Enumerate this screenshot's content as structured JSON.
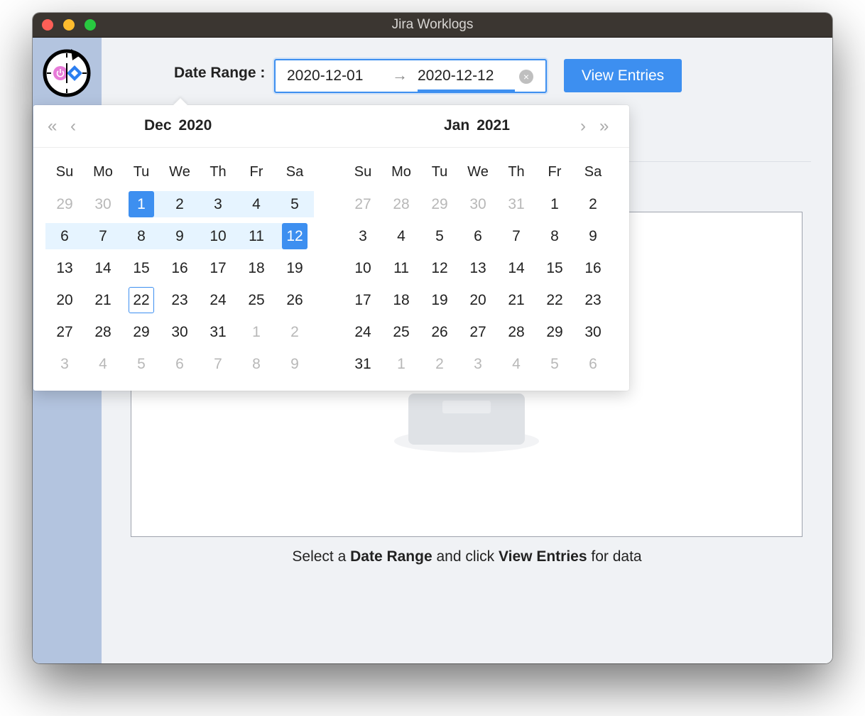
{
  "window": {
    "title": "Jira Worklogs"
  },
  "toolbar": {
    "date_range_label": "Date Range :",
    "start_date": "2020-12-01",
    "range_arrow": "→",
    "end_date": "2020-12-12",
    "clear_icon": "×",
    "view_button": "View Entries"
  },
  "empty_state": {
    "part1": "Select a ",
    "bold1": "Date Range",
    "part2": " and click ",
    "bold2": "View Entries",
    "part3": " for data"
  },
  "colors": {
    "accent": "#3d8ff0",
    "range_fill": "#e6f4ff",
    "sidebar": "#b3c4df"
  },
  "calendar": {
    "weekdays": [
      "Su",
      "Mo",
      "Tu",
      "We",
      "Th",
      "Fr",
      "Sa"
    ],
    "nav": {
      "super_prev": "«",
      "prev": "‹",
      "next": "›",
      "super_next": "»"
    },
    "left": {
      "month": "Dec",
      "year": "2020",
      "weeks": [
        [
          "29",
          "30",
          "1",
          "2",
          "3",
          "4",
          "5"
        ],
        [
          "6",
          "7",
          "8",
          "9",
          "10",
          "11",
          "12"
        ],
        [
          "13",
          "14",
          "15",
          "16",
          "17",
          "18",
          "19"
        ],
        [
          "20",
          "21",
          "22",
          "23",
          "24",
          "25",
          "26"
        ],
        [
          "27",
          "28",
          "29",
          "30",
          "31",
          "1",
          "2"
        ],
        [
          "3",
          "4",
          "5",
          "6",
          "7",
          "8",
          "9"
        ]
      ],
      "other_month": [
        [
          1,
          1,
          0,
          0,
          0,
          0,
          0
        ],
        [
          0,
          0,
          0,
          0,
          0,
          0,
          0
        ],
        [
          0,
          0,
          0,
          0,
          0,
          0,
          0
        ],
        [
          0,
          0,
          0,
          0,
          0,
          0,
          0
        ],
        [
          0,
          0,
          0,
          0,
          0,
          1,
          1
        ],
        [
          1,
          1,
          1,
          1,
          1,
          1,
          1
        ]
      ],
      "range_start": [
        0,
        2
      ],
      "range_end": [
        1,
        6
      ],
      "today": [
        3,
        2
      ]
    },
    "right": {
      "month": "Jan",
      "year": "2021",
      "weeks": [
        [
          "27",
          "28",
          "29",
          "30",
          "31",
          "1",
          "2"
        ],
        [
          "3",
          "4",
          "5",
          "6",
          "7",
          "8",
          "9"
        ],
        [
          "10",
          "11",
          "12",
          "13",
          "14",
          "15",
          "16"
        ],
        [
          "17",
          "18",
          "19",
          "20",
          "21",
          "22",
          "23"
        ],
        [
          "24",
          "25",
          "26",
          "27",
          "28",
          "29",
          "30"
        ],
        [
          "31",
          "1",
          "2",
          "3",
          "4",
          "5",
          "6"
        ]
      ],
      "other_month": [
        [
          1,
          1,
          1,
          1,
          1,
          0,
          0
        ],
        [
          0,
          0,
          0,
          0,
          0,
          0,
          0
        ],
        [
          0,
          0,
          0,
          0,
          0,
          0,
          0
        ],
        [
          0,
          0,
          0,
          0,
          0,
          0,
          0
        ],
        [
          0,
          0,
          0,
          0,
          0,
          0,
          0
        ],
        [
          0,
          1,
          1,
          1,
          1,
          1,
          1
        ]
      ]
    }
  }
}
